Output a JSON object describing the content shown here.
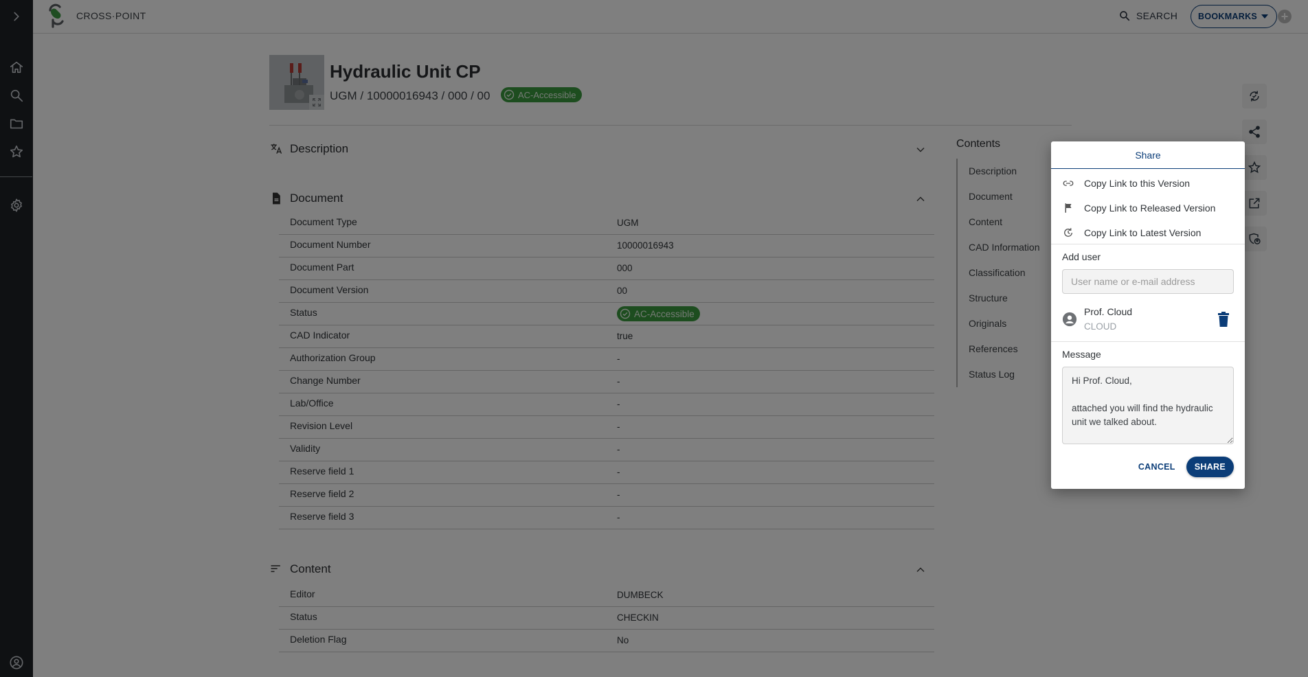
{
  "app": {
    "brand": "CROSS·POINT",
    "search_label": "SEARCH",
    "bookmarks_label": "BOOKMARKS",
    "colors": {
      "primary": "#0b3d78",
      "success": "#3a9a3e",
      "rail": "#1e2227"
    }
  },
  "rail": {
    "items": [
      {
        "name": "expand",
        "icon": "chevron-right-icon"
      },
      {
        "name": "home",
        "icon": "home-icon"
      },
      {
        "name": "search",
        "icon": "search-icon"
      },
      {
        "name": "folder",
        "icon": "folder-icon"
      },
      {
        "name": "favorites",
        "icon": "star-icon"
      },
      {
        "name": "settings",
        "icon": "gear-icon"
      },
      {
        "name": "account",
        "icon": "account-circle-icon"
      }
    ]
  },
  "header": {
    "title": "Hydraulic Unit CP",
    "subtitle": "UGM / 10000016943 / 000 / 00",
    "status_badge": "AC-Accessible"
  },
  "sections": {
    "description": {
      "title": "Description"
    },
    "document": {
      "title": "Document",
      "rows": [
        {
          "label": "Document Type",
          "value": "UGM"
        },
        {
          "label": "Document Number",
          "value": "10000016943"
        },
        {
          "label": "Document Part",
          "value": "000"
        },
        {
          "label": "Document Version",
          "value": "00"
        },
        {
          "label": "Status",
          "value": "AC-Accessible"
        },
        {
          "label": "CAD Indicator",
          "value": "true"
        },
        {
          "label": "Authorization Group",
          "value": "-"
        },
        {
          "label": "Change Number",
          "value": "-"
        },
        {
          "label": "Lab/Office",
          "value": "-"
        },
        {
          "label": "Revision Level",
          "value": "-"
        },
        {
          "label": "Validity",
          "value": "-"
        },
        {
          "label": "Reserve field 1",
          "value": "-"
        },
        {
          "label": "Reserve field 2",
          "value": "-"
        },
        {
          "label": "Reserve field 3",
          "value": "-"
        }
      ]
    },
    "content": {
      "title": "Content",
      "rows": [
        {
          "label": "Editor",
          "value": "DUMBECK"
        },
        {
          "label": "Status",
          "value": "CHECKIN"
        },
        {
          "label": "Deletion Flag",
          "value": "No"
        }
      ]
    }
  },
  "toc": {
    "title": "Contents",
    "items": [
      "Description",
      "Document",
      "Content",
      "CAD Information",
      "Classification",
      "Structure",
      "Originals",
      "References",
      "Status Log"
    ]
  },
  "actions": [
    "sync-check-icon",
    "share-icon",
    "star-icon",
    "open-external-icon",
    "shield-user-icon"
  ],
  "share_dialog": {
    "title": "Share",
    "menu": [
      {
        "label": "Copy Link to this Version",
        "icon": "link-icon"
      },
      {
        "label": "Copy Link to Released Version",
        "icon": "flag-icon"
      },
      {
        "label": "Copy Link to Latest Version",
        "icon": "history-icon"
      }
    ],
    "add_user_label": "Add user",
    "user_input_placeholder": "User name or e-mail address",
    "user_input_value": "",
    "users": [
      {
        "name": "Prof. Cloud",
        "id": "CLOUD"
      }
    ],
    "message_label": "Message",
    "message_value": "Hi Prof. Cloud,\n\nattached you will find the hydraulic unit we talked about.",
    "cancel_label": "CANCEL",
    "share_label": "SHARE"
  }
}
